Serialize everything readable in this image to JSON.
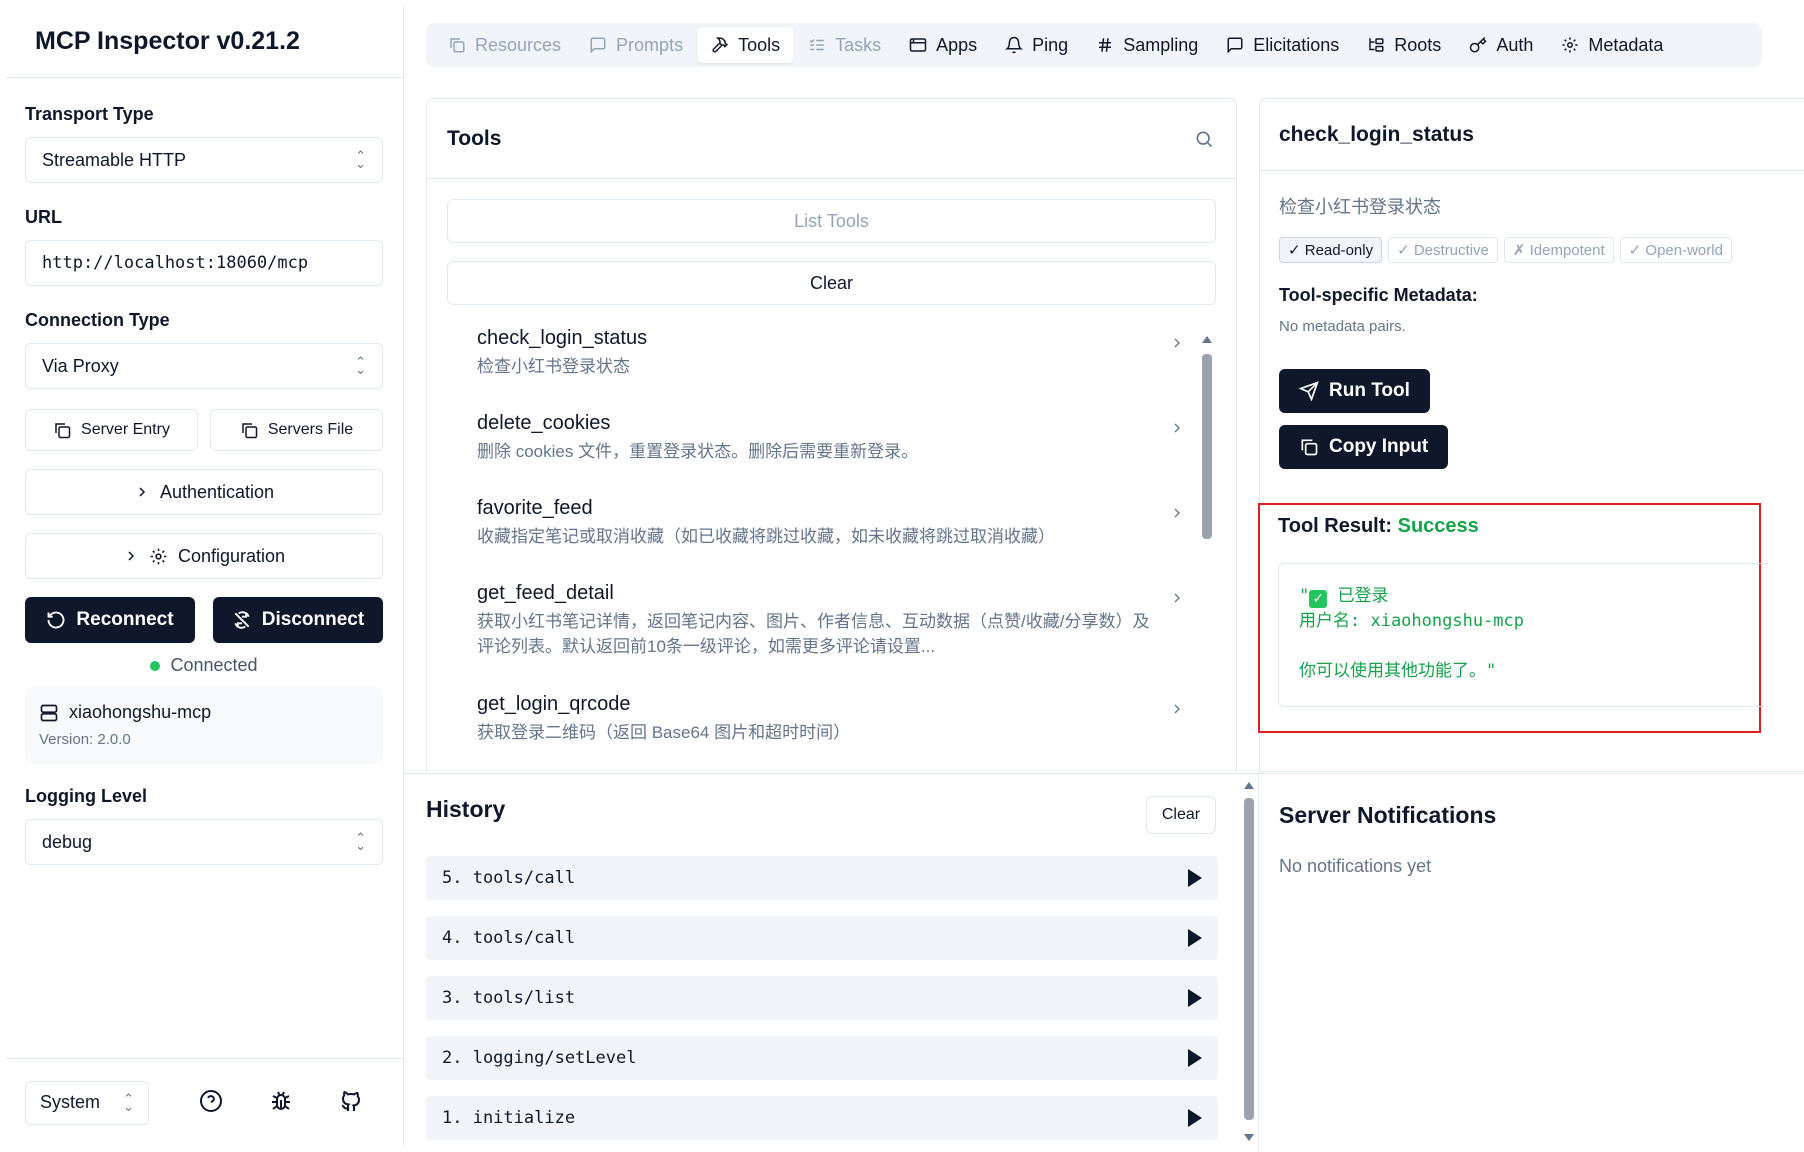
{
  "app": {
    "title": "MCP Inspector v0.21.2"
  },
  "sidebar": {
    "transport_label": "Transport Type",
    "transport_value": "Streamable HTTP",
    "url_label": "URL",
    "url_value": "http://localhost:18060/mcp",
    "connection_label": "Connection Type",
    "connection_value": "Via Proxy",
    "server_entry": "Server Entry",
    "servers_file": "Servers File",
    "authentication": "Authentication",
    "configuration": "Configuration",
    "reconnect": "Reconnect",
    "disconnect": "Disconnect",
    "status": "Connected",
    "server_name": "xiaohongshu-mcp",
    "server_version": "Version: 2.0.0",
    "logging_label": "Logging Level",
    "logging_value": "debug",
    "theme_value": "System"
  },
  "tabs": [
    {
      "label": "Resources",
      "icon": "file-icon",
      "disabled": true
    },
    {
      "label": "Prompts",
      "icon": "message-icon",
      "disabled": true
    },
    {
      "label": "Tools",
      "icon": "hammer-icon",
      "active": true
    },
    {
      "label": "Tasks",
      "icon": "list-check-icon",
      "disabled": true
    },
    {
      "label": "Apps",
      "icon": "app-window-icon"
    },
    {
      "label": "Ping",
      "icon": "bell-icon"
    },
    {
      "label": "Sampling",
      "icon": "hash-icon"
    },
    {
      "label": "Elicitations",
      "icon": "message-square-icon"
    },
    {
      "label": "Roots",
      "icon": "folder-tree-icon"
    },
    {
      "label": "Auth",
      "icon": "key-icon"
    },
    {
      "label": "Metadata",
      "icon": "gear-icon"
    }
  ],
  "tools": {
    "title": "Tools",
    "list_button": "List Tools",
    "clear_button": "Clear",
    "items": [
      {
        "name": "check_login_status",
        "desc": "检查小红书登录状态"
      },
      {
        "name": "delete_cookies",
        "desc": "删除 cookies 文件，重置登录状态。删除后需要重新登录。"
      },
      {
        "name": "favorite_feed",
        "desc": "收藏指定笔记或取消收藏（如已收藏将跳过收藏，如未收藏将跳过取消收藏）"
      },
      {
        "name": "get_feed_detail",
        "desc": "获取小红书笔记详情，返回笔记内容、图片、作者信息、互动数据（点赞/收藏/分享数）及评论列表。默认返回前10条一级评论，如需更多评论请设置..."
      },
      {
        "name": "get_login_qrcode",
        "desc": "获取登录二维码（返回 Base64 图片和超时时间）"
      }
    ]
  },
  "detail": {
    "title": "check_login_status",
    "desc": "检查小红书登录状态",
    "badges": [
      {
        "label": "✓ Read-only",
        "on": true
      },
      {
        "label": "✓ Destructive",
        "on": false
      },
      {
        "label": "✗ Idempotent",
        "on": false
      },
      {
        "label": "✓ Open-world",
        "on": false
      }
    ],
    "meta_title": "Tool-specific Metadata:",
    "meta_none": "No metadata pairs.",
    "run_button": "Run Tool",
    "copy_button": "Copy Input",
    "result_label": "Tool Result:",
    "result_status": "Success",
    "result_line1_prefix": "\"",
    "result_line1_text": " 已登录",
    "result_line2": "用户名: xiaohongshu-mcp",
    "result_line3": "你可以使用其他功能了。\""
  },
  "history": {
    "title": "History",
    "clear": "Clear",
    "items": [
      "5. tools/call",
      "4. tools/call",
      "3. tools/list",
      "2. logging/setLevel",
      "1. initialize"
    ]
  },
  "notifications": {
    "title": "Server Notifications",
    "empty": "No notifications yet"
  }
}
